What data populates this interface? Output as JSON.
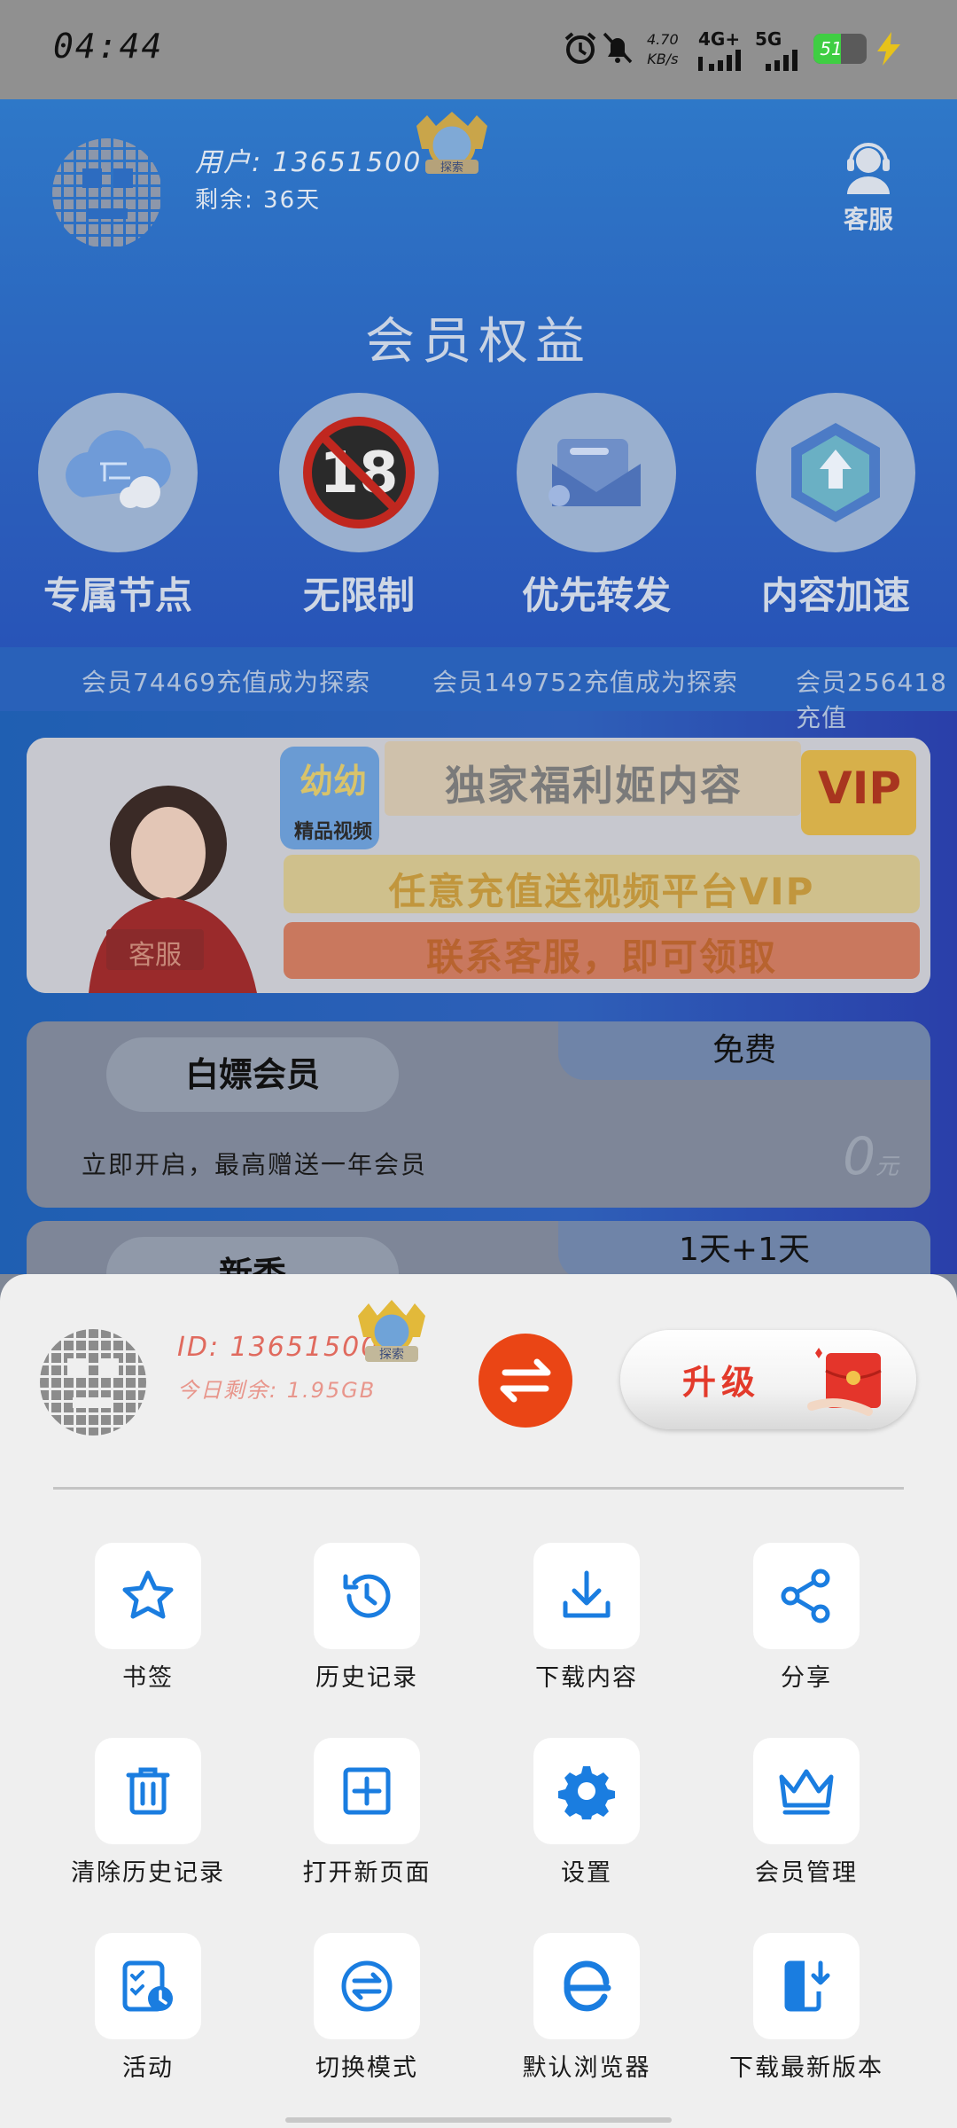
{
  "status_bar": {
    "time": "04:44",
    "net_speed_value": "4.70",
    "net_speed_unit": "KB/s",
    "signal1_label": "4G+",
    "signal2_label": "5G",
    "battery_level": "51",
    "battery_fraction": 0.51
  },
  "header": {
    "user_line": "用户: 13651500",
    "remain_line": "剩余: 36天",
    "badge_text": "探索",
    "service_label": "客服"
  },
  "benefits": {
    "title": "会员权益",
    "items": [
      {
        "label": "专属节点",
        "icon": "cloud-icon"
      },
      {
        "label": "无限制",
        "icon": "no-18-icon"
      },
      {
        "label": "优先转发",
        "icon": "mail-forward-icon"
      },
      {
        "label": "内容加速",
        "icon": "speed-up-icon"
      }
    ]
  },
  "ticker": [
    "会员74469充值成为探索",
    "会员149752充值成为探索",
    "会员256418充值"
  ],
  "banner": {
    "logo_top": "幼幼",
    "logo_bottom": "精品视频",
    "headline": "独家福利姬内容",
    "vip": "VIP",
    "line1": "任意充值送视频平台VIP",
    "line2": "联系客服，即可领取",
    "badge": "客服"
  },
  "cards": [
    {
      "name": "白嫖会员",
      "tag": "免费",
      "desc": "立即开启，最高赠送一年会员",
      "price": "0",
      "unit": "元"
    },
    {
      "name": "新秀",
      "tag": "1天+1天"
    }
  ],
  "sheet": {
    "id_line": "ID: 13651500",
    "remain_line": "今日剩余: 1.95GB",
    "badge_text": "探索",
    "upgrade_label": "升级",
    "menu": [
      {
        "label": "书签",
        "icon": "star-icon"
      },
      {
        "label": "历史记录",
        "icon": "history-icon"
      },
      {
        "label": "下载内容",
        "icon": "download-icon"
      },
      {
        "label": "分享",
        "icon": "share-icon"
      },
      {
        "label": "清除历史记录",
        "icon": "trash-icon"
      },
      {
        "label": "打开新页面",
        "icon": "plus-square-icon"
      },
      {
        "label": "设置",
        "icon": "gear-icon"
      },
      {
        "label": "会员管理",
        "icon": "crown-icon"
      },
      {
        "label": "活动",
        "icon": "clipboard-clock-icon"
      },
      {
        "label": "切换模式",
        "icon": "swap-icon"
      },
      {
        "label": "默认浏览器",
        "icon": "browser-e-icon"
      },
      {
        "label": "下载最新版本",
        "icon": "phone-download-icon"
      }
    ]
  },
  "colors": {
    "accent_blue": "#1a7de0",
    "swap_orange": "#ea4515",
    "upgrade_red": "#e33a2b",
    "sheet_bg": "#efefef"
  }
}
